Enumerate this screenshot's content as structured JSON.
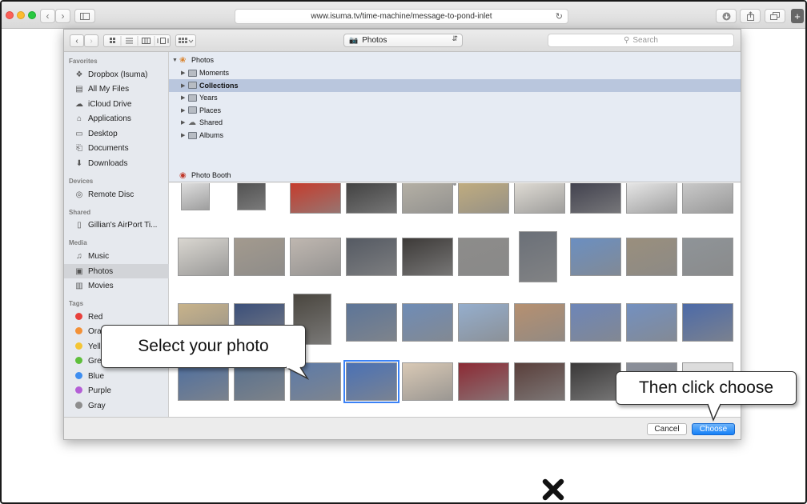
{
  "browser": {
    "url": "www.isuma.tv/time-machine/message-to-pond-inlet"
  },
  "dialog": {
    "location": "Photos",
    "search_placeholder": "Search"
  },
  "sidebar": {
    "sections": [
      {
        "title": "Favorites",
        "items": [
          {
            "label": "Dropbox (Isuma)",
            "icon": "dropbox-icon"
          },
          {
            "label": "All My Files",
            "icon": "all-files-icon"
          },
          {
            "label": "iCloud Drive",
            "icon": "cloud-icon"
          },
          {
            "label": "Applications",
            "icon": "applications-icon"
          },
          {
            "label": "Desktop",
            "icon": "desktop-icon"
          },
          {
            "label": "Documents",
            "icon": "documents-icon"
          },
          {
            "label": "Downloads",
            "icon": "downloads-icon"
          }
        ]
      },
      {
        "title": "Devices",
        "items": [
          {
            "label": "Remote Disc",
            "icon": "disc-icon"
          }
        ]
      },
      {
        "title": "Shared",
        "items": [
          {
            "label": "Gillian's AirPort Ti...",
            "icon": "airport-icon"
          }
        ]
      },
      {
        "title": "Media",
        "items": [
          {
            "label": "Music",
            "icon": "music-icon"
          },
          {
            "label": "Photos",
            "icon": "camera-icon"
          },
          {
            "label": "Movies",
            "icon": "film-icon"
          }
        ]
      },
      {
        "title": "Tags",
        "items": [
          {
            "label": "Red",
            "color": "#e8413c"
          },
          {
            "label": "Orange",
            "color": "#f39137"
          },
          {
            "label": "Yellow",
            "color": "#f4c534"
          },
          {
            "label": "Green",
            "color": "#5fbf3c"
          },
          {
            "label": "Blue",
            "color": "#3f8ef0"
          },
          {
            "label": "Purple",
            "color": "#b45fd6"
          },
          {
            "label": "Gray",
            "color": "#8e8e8e"
          }
        ]
      }
    ],
    "selected": "Photos"
  },
  "tree": {
    "root": "Photos",
    "items": [
      "Moments",
      "Collections",
      "Years",
      "Places",
      "Shared",
      "Albums"
    ],
    "selected": "Collections",
    "extra": "Photo Booth"
  },
  "footer": {
    "cancel": "Cancel",
    "choose": "Choose"
  },
  "callouts": {
    "select": "Select your photo",
    "choose": "Then click choose"
  }
}
